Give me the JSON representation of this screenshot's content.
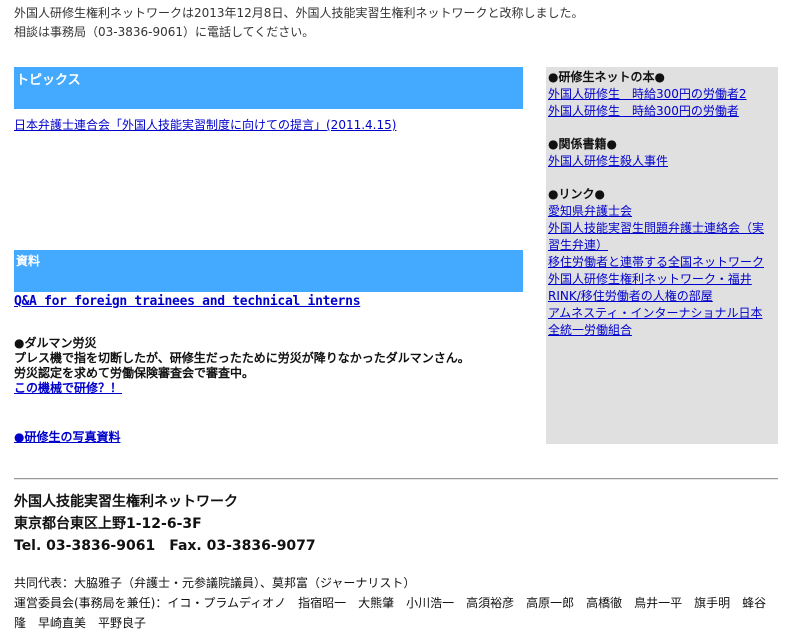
{
  "notice": {
    "line1": "外国人研修生権利ネットワークは2013年12月8日、外国人技能実習生権利ネットワークと改称しました。",
    "line2": "相談は事務局（03-3836-9061）に電話してください。"
  },
  "topics": {
    "heading": "トピックス",
    "link": "日本弁護士連合会「外国人技能実習制度に向けての提言」(2011.4.15)"
  },
  "shiryo": {
    "heading": "資料",
    "qa_link": "Q&A for foreign trainees and technical interns",
    "accident_title": "●ダルマン労災",
    "accident_line1": "プレス機で指を切断したが、研修生だったために労災が降りなかったダルマンさん。",
    "accident_line2": "労災認定を求めて労働保険審査会で審査中。",
    "accident_link": "この機械で研修？！",
    "photo_link": "●研修生の写真資料"
  },
  "sidebar": {
    "books_heading": "●研修生ネットの本●",
    "books": [
      "外国人研修生　時給300円の労働者2",
      "外国人研修生　時給300円の労働者"
    ],
    "related_heading": "●関係書籍●",
    "related": [
      "外国人研修生殺人事件"
    ],
    "links_heading": "●リンク●",
    "links": [
      "愛知県弁護士会",
      "外国人技能実習生問題弁護士連絡会（実習生弁連）",
      "移住労働者と連帯する全国ネットワーク",
      "外国人研修生権利ネットワーク・福井",
      "RINK/移住労働者の人権の部屋",
      "アムネスティ・インターナショナル日本",
      "全統一労働組合"
    ]
  },
  "footer": {
    "org_name": "外国人技能実習生権利ネットワーク",
    "address": "東京都台東区上野1-12-6-3F",
    "phone": "Tel. 03-3836-9061　Fax. 03-3836-9077",
    "reps": "共同代表：大脇雅子（弁護士・元参議院議員）、莫邦富（ジャーナリスト）",
    "committee": "運営委員会(事務局を兼任)：イコ・プラムディオノ　指宿昭一　大熊肇　小川浩一　高須裕彦　高原一郎　高橋徹　鳥井一平　旗手明　蜂谷隆　早崎直美　平野良子"
  }
}
